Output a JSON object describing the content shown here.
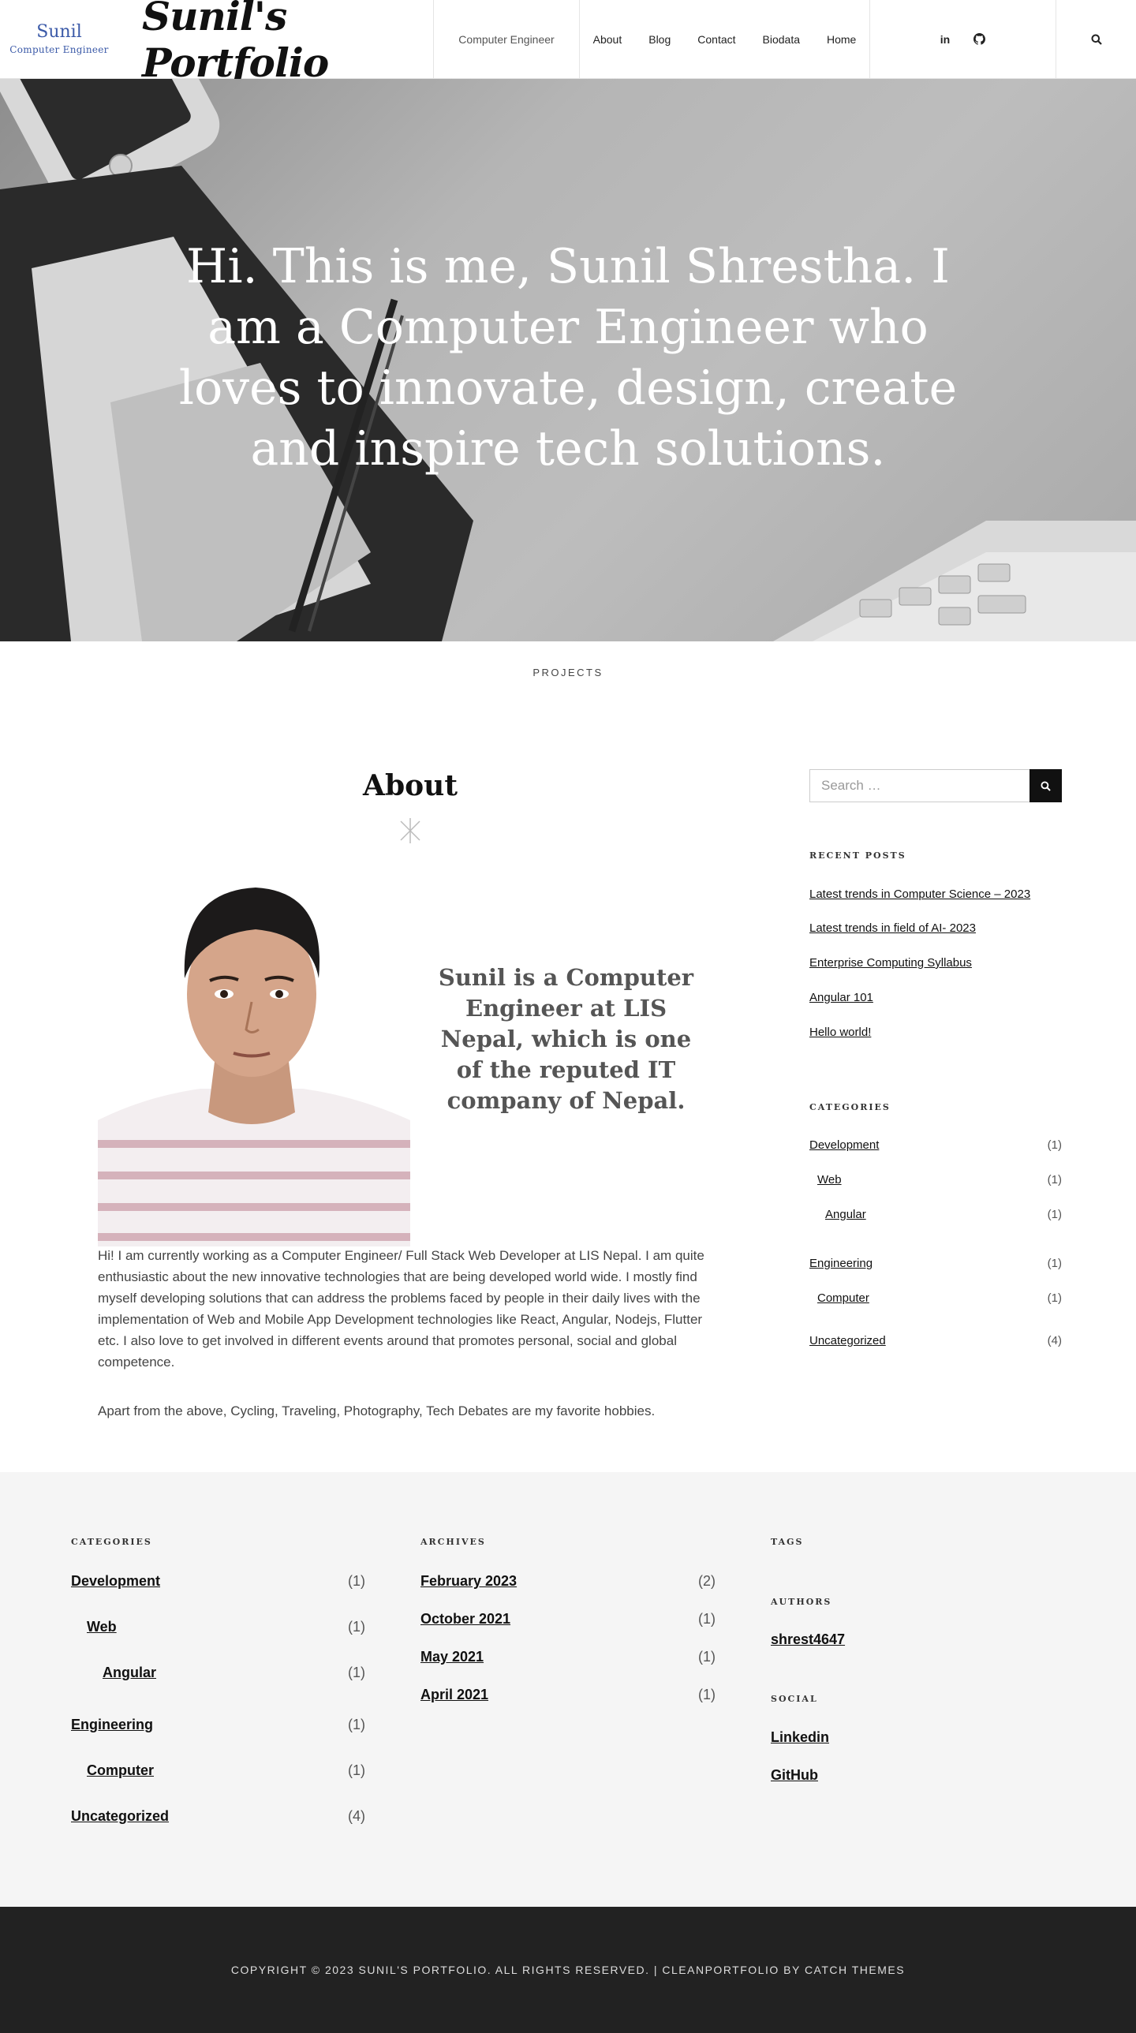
{
  "header": {
    "logo_name": "Sunil",
    "logo_sub": "Computer Engineer",
    "site_title": "Sunil's Portfolio",
    "tagline": "Computer Engineer",
    "nav": [
      "About",
      "Blog",
      "Contact",
      "Biodata",
      "Home"
    ],
    "social": {
      "linkedin": "in"
    }
  },
  "hero": {
    "text": "Hi. This is me, Sunil Shrestha. I am a Computer Engineer who loves to innovate, design, create and inspire tech solutions."
  },
  "projects_label": "PROJECTS",
  "main": {
    "title": "About",
    "quote": "Sunil is a Computer Engineer at LIS Nepal, which is one of the reputed IT company of Nepal.",
    "paragraph1": "Hi! I am currently working as a Computer Engineer/ Full Stack Web Developer at LIS Nepal. I am quite enthusiastic about the new innovative technologies that are being developed world wide. I mostly find myself developing solutions that can address the problems faced by people in their daily lives with the implementation of Web and Mobile App Development technologies like React, Angular, Nodejs, Flutter etc. I also love to get involved in different events around that promotes personal, social and global competence.",
    "paragraph2": "Apart from the above, Cycling, Traveling, Photography, Tech Debates are my favorite hobbies."
  },
  "sidebar": {
    "search_placeholder": "Search …",
    "recent_heading": "RECENT POSTS",
    "recent_posts": [
      "Latest trends in Computer Science – 2023",
      "Latest trends in field of AI- 2023",
      "Enterprise Computing Syllabus",
      "Angular 101",
      "Hello world!"
    ],
    "categories_heading": "CATEGORIES",
    "categories": [
      {
        "label": "Development",
        "count": "(1)"
      },
      {
        "label": "Web",
        "count": "(1)"
      },
      {
        "label": "Angular",
        "count": "(1)"
      },
      {
        "label": "Engineering",
        "count": "(1)"
      },
      {
        "label": "Computer",
        "count": "(1)"
      },
      {
        "label": "Uncategorized",
        "count": "(4)"
      }
    ]
  },
  "footer_widgets": {
    "categories_heading": "CATEGORIES",
    "categories": [
      {
        "label": "Development",
        "count": "(1)"
      },
      {
        "label": "Web",
        "count": "(1)"
      },
      {
        "label": "Angular",
        "count": "(1)"
      },
      {
        "label": "Engineering",
        "count": "(1)"
      },
      {
        "label": "Computer",
        "count": "(1)"
      },
      {
        "label": "Uncategorized",
        "count": "(4)"
      }
    ],
    "archives_heading": "ARCHIVES",
    "archives": [
      {
        "label": "February 2023",
        "count": "(2)"
      },
      {
        "label": "October 2021",
        "count": "(1)"
      },
      {
        "label": "May 2021",
        "count": "(1)"
      },
      {
        "label": "April 2021",
        "count": "(1)"
      }
    ],
    "tags_heading": "TAGS",
    "authors_heading": "AUTHORS",
    "author": "shrest4647",
    "social_heading": "SOCIAL",
    "social_links": [
      "Linkedin",
      "GitHub"
    ]
  },
  "footer": {
    "copyright": "COPYRIGHT © 2023 SUNIL'S PORTFOLIO. ALL RIGHTS RESERVED. | CLEANPORTFOLIO BY CATCH THEMES"
  }
}
